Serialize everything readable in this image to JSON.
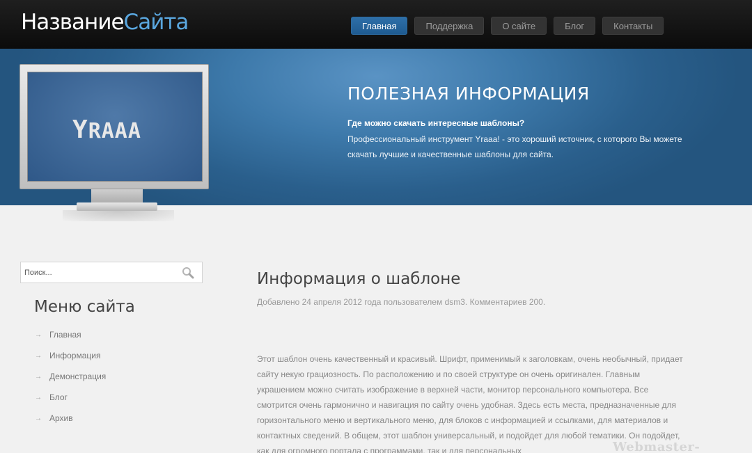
{
  "site": {
    "logo_white": "Название",
    "logo_blue": "Сайта"
  },
  "nav": {
    "items": [
      "Главная",
      "Поддержка",
      "О сайте",
      "Блог",
      "Контакты"
    ],
    "active": "Главная"
  },
  "banner": {
    "screen_logo_big": "Y",
    "screen_logo_rest": "RAAA",
    "title": "ПОЛЕЗНАЯ ИНФОРМАЦИЯ",
    "subtitle": "Где можно скачать интересные шаблоны?",
    "text": "Профессиональный инструмент Yraaa! - это хороший источник, с которого Вы можете скачать лучшие и качественные шаблоны для сайта."
  },
  "search": {
    "placeholder": "Поиск..."
  },
  "sidebar": {
    "menu_title": "Меню сайта",
    "items": [
      {
        "label": "Главная"
      },
      {
        "label": "Информация"
      },
      {
        "label": "Демонстрация"
      },
      {
        "label": "Блог"
      },
      {
        "label": "Архив"
      }
    ]
  },
  "article": {
    "title": "Информация о шаблоне",
    "meta": "Добавлено 24 апреля 2012 года пользователем dsm3. Комментариев 200.",
    "body": "Этот шаблон очень качественный и красивый. Шрифт, применимый к заголовкам, очень необычный, придает сайту некую грациозность. По расположению и по своей структуре он очень оригинален. Главным украшением можно считать изображение в верхней части, монитор персонального компьютера. Все смотрится очень гармонично и навигация по сайту очень удобная. Здесь есть места, предназначенные для горизонтального меню и вертикального меню, для блоков с информацией и ссылками, для материалов и контактных сведений. В общем, этот шаблон универсальный, и подойдет для любой тематики. Он подойдет, как для огромного портала с программами, так и для персональных"
  },
  "watermark": "Webmaster-uCoz.ru",
  "colors": {
    "accent": "#5aa7df",
    "nav_active": "#1f5b91",
    "header_bg": "#141414",
    "banner_bg": "#3d79aa"
  }
}
